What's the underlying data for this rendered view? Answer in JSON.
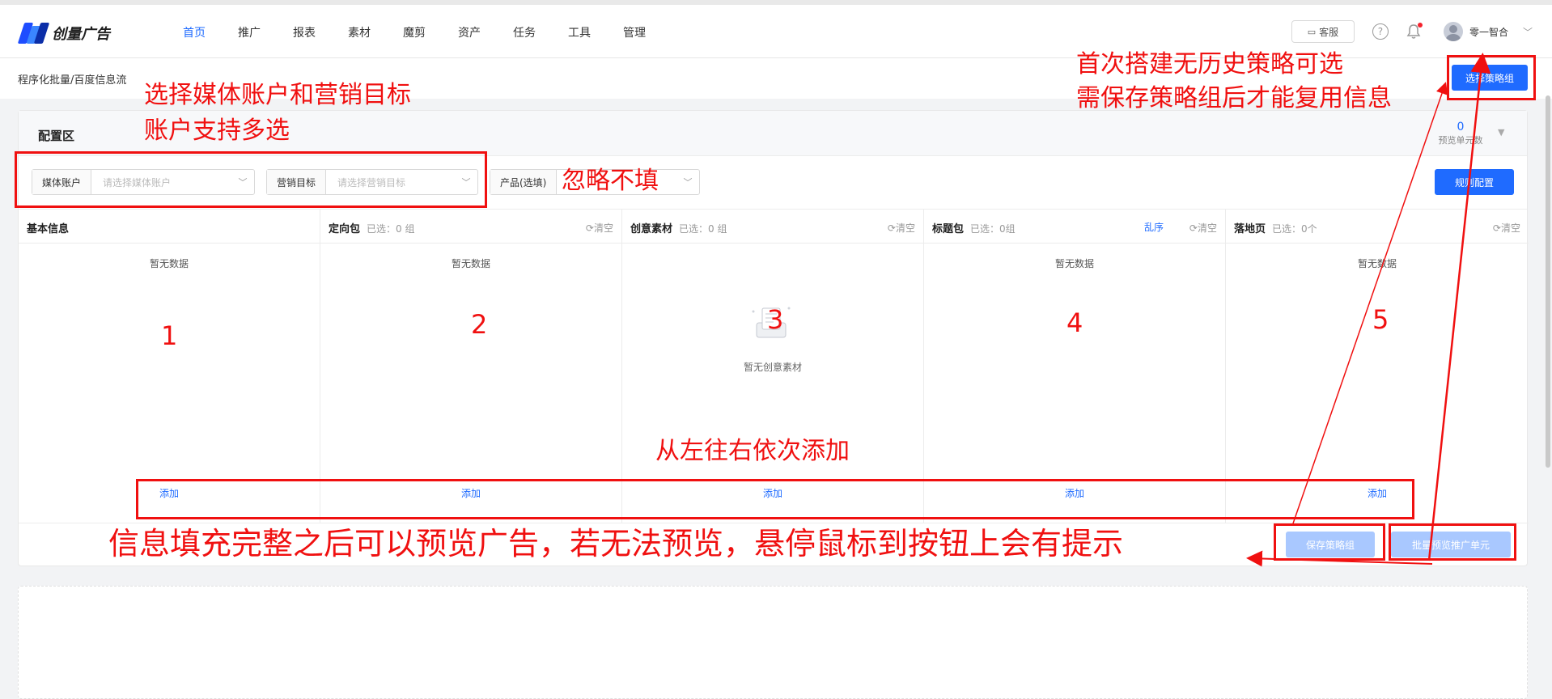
{
  "app": {
    "logo_text": "创量广告",
    "nav": [
      "首页",
      "推广",
      "报表",
      "素材",
      "魔剪",
      "资产",
      "任务",
      "工具",
      "管理"
    ],
    "active_nav_index": 0,
    "kefu": "客服",
    "username": "零一智合"
  },
  "breadcrumb": "程序化批量/百度信息流",
  "select_strategy_button": "选择策略组",
  "panel": {
    "title": "配置区",
    "preview_count": "0",
    "preview_label": "预览单元数"
  },
  "filters": [
    {
      "label": "媒体账户",
      "placeholder": "请选择媒体账户"
    },
    {
      "label": "营销目标",
      "placeholder": "请选择营销目标"
    },
    {
      "label": "产品(选填)",
      "placeholder": ""
    }
  ],
  "rule_button": "规则配置",
  "columns": [
    {
      "title": "基本信息",
      "sub": "",
      "clear": "",
      "shuffle": "",
      "empty": "暂无数据",
      "add": "添加"
    },
    {
      "title": "定向包",
      "sub": "已选：0 组",
      "clear": "清空",
      "shuffle": "",
      "empty": "暂无数据",
      "add": "添加"
    },
    {
      "title": "创意素材",
      "sub": "已选：0 组",
      "clear": "清空",
      "shuffle": "",
      "empty": "",
      "empty_illustration": "暂无创意素材",
      "add": "添加"
    },
    {
      "title": "标题包",
      "sub": "已选：0组",
      "clear": "清空",
      "shuffle": "乱序",
      "empty": "暂无数据",
      "add": "添加"
    },
    {
      "title": "落地页",
      "sub": "已选：0个",
      "clear": "清空",
      "shuffle": "",
      "empty": "暂无数据",
      "add": "添加"
    }
  ],
  "footer_buttons": {
    "save": "保存策略组",
    "batch_preview": "批量预览推广单元"
  },
  "annotations": {
    "select_media": [
      "选择媒体账户和营销目标",
      "账户支持多选"
    ],
    "ignore": "忽略不填",
    "first_build": [
      "首次搭建无历史策略可选",
      "需保存策略组后才能复用信息"
    ],
    "left_to_right": "从左往右依次添加",
    "preview_hint": "信息填充完整之后可以预览广告，若无法预览，悬停鼠标到按钮上会有提示",
    "numbers": [
      "1",
      "2",
      "3",
      "4",
      "5"
    ]
  },
  "colors": {
    "primary": "#1f6bff",
    "annotation": "#f01010",
    "disabled_button": "#a9c8ff"
  }
}
